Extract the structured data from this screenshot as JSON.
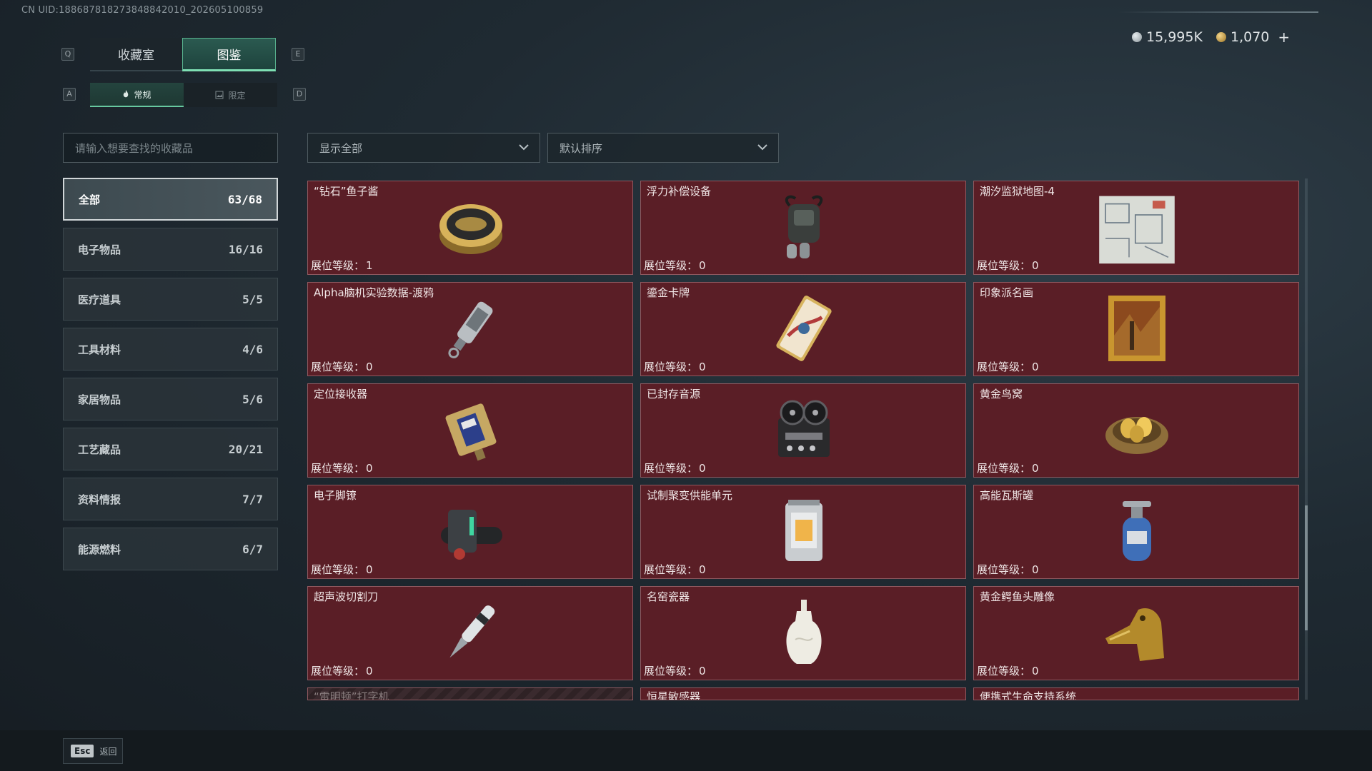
{
  "uid": "CN UID:18868781827384884201​0_202605100859",
  "hotkeys": {
    "prev_tab": "Q",
    "next_tab": "E",
    "prev_sub": "A",
    "next_sub": "D"
  },
  "tabs": [
    {
      "label": "收藏室",
      "active": false
    },
    {
      "label": "图鉴",
      "active": true
    }
  ],
  "subtabs": [
    {
      "label": "常规",
      "active": true
    },
    {
      "label": "限定",
      "active": false
    }
  ],
  "currency": {
    "silver": "15,995K",
    "gold": "1,070",
    "add_label": "+"
  },
  "search": {
    "placeholder": "请输入想要查找的收藏品"
  },
  "filters": {
    "show": "显示全部",
    "sort": "默认排序"
  },
  "categories": [
    {
      "label": "全部",
      "count": "63/68",
      "active": true
    },
    {
      "label": "电子物品",
      "count": "16/16"
    },
    {
      "label": "医疗道具",
      "count": "5/5"
    },
    {
      "label": "工具材料",
      "count": "4/6"
    },
    {
      "label": "家居物品",
      "count": "5/6"
    },
    {
      "label": "工艺藏品",
      "count": "20/21"
    },
    {
      "label": "资料情报",
      "count": "7/7"
    },
    {
      "label": "能源燃料",
      "count": "6/7"
    }
  ],
  "level_label": "展位等级：",
  "items": [
    {
      "name": "“钻石”鱼子酱",
      "level": "1",
      "icon": "caviar-tin-icon"
    },
    {
      "name": "浮力补偿设备",
      "level": "0",
      "icon": "buoyancy-device-icon"
    },
    {
      "name": "潮汐监狱地图-4",
      "level": "0",
      "icon": "prison-map-icon"
    },
    {
      "name": "Alpha脑机实验数据-渡鸦",
      "level": "0",
      "icon": "data-drive-icon"
    },
    {
      "name": "鎏金卡牌",
      "level": "0",
      "icon": "gilded-card-icon"
    },
    {
      "name": "印象派名画",
      "level": "0",
      "icon": "framed-painting-icon"
    },
    {
      "name": "定位接收器",
      "level": "0",
      "icon": "gps-receiver-icon"
    },
    {
      "name": "已封存音源",
      "level": "0",
      "icon": "reel-recorder-icon"
    },
    {
      "name": "黄金鸟窝",
      "level": "0",
      "icon": "golden-nest-icon"
    },
    {
      "name": "电子脚镣",
      "level": "0",
      "icon": "ankle-monitor-icon"
    },
    {
      "name": "试制聚变供能单元",
      "level": "0",
      "icon": "fusion-cell-icon"
    },
    {
      "name": "高能瓦斯罐",
      "level": "0",
      "icon": "gas-canister-icon"
    },
    {
      "name": "超声波切割刀",
      "level": "0",
      "icon": "ultrasonic-cutter-icon"
    },
    {
      "name": "名窑瓷器",
      "level": "0",
      "icon": "porcelain-vase-icon"
    },
    {
      "name": "黄金鳄鱼头雕像",
      "level": "0",
      "icon": "crocodile-statue-icon"
    }
  ],
  "partial_items": [
    {
      "name": "“雷明顿”打字机"
    },
    {
      "name": "恒星敏感器"
    },
    {
      "name": "便携式生命支持系统"
    }
  ],
  "esc": {
    "key": "Esc",
    "label": "返回"
  }
}
